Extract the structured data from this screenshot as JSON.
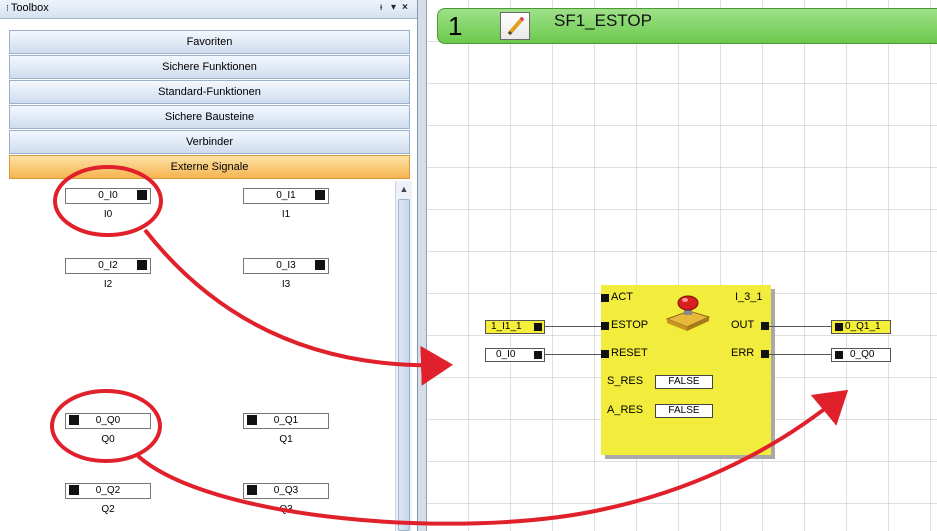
{
  "toolbox": {
    "title": "Toolbox",
    "pin_glyph": "ᵻ",
    "menu_glyph": "▾",
    "close_glyph": "×",
    "categories": [
      "Favoriten",
      "Sichere Funktionen",
      "Standard-Funktionen",
      "Sichere Bausteine",
      "Verbinder",
      "Externe Signale"
    ],
    "active_category": "Externe Signale",
    "signals": [
      {
        "label": "0_I0",
        "caption": "I0"
      },
      {
        "label": "0_I1",
        "caption": "I1"
      },
      {
        "label": "0_I2",
        "caption": "I2"
      },
      {
        "label": "0_I3",
        "caption": "I3"
      },
      {
        "label": "0_Q0",
        "caption": "Q0"
      },
      {
        "label": "0_Q1",
        "caption": "Q1"
      },
      {
        "label": "0_Q2",
        "caption": "Q2"
      },
      {
        "label": "0_Q3",
        "caption": "Q3"
      }
    ]
  },
  "sheet": {
    "number": "1",
    "name": "SF1_ESTOP"
  },
  "function_block": {
    "instance": "I_3_1",
    "inputs": [
      "ACT",
      "ESTOP",
      "RESET",
      "S_RES",
      "A_RES"
    ],
    "outputs": [
      "OUT",
      "ERR"
    ],
    "s_res_value": "FALSE",
    "a_res_value": "FALSE"
  },
  "connections": {
    "estop_input": "1_I1_1",
    "reset_input": "0_I0",
    "out_output": "0_Q1_1",
    "err_output": "0_Q0"
  },
  "colors": {
    "annotation": "#e0202a",
    "block": "#f2ec3c",
    "active_tab": "#f6b450",
    "sheet_bar": "#6bc94c"
  }
}
